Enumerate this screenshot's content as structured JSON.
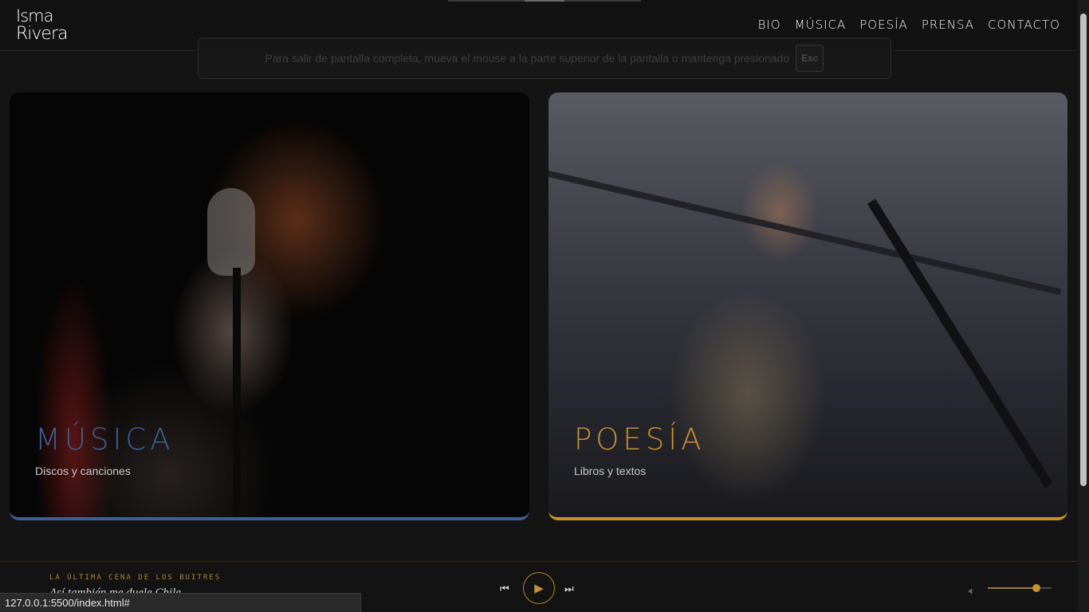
{
  "header": {
    "logo_line1": "Isma",
    "logo_line2": "Rivera",
    "nav": [
      "BIO",
      "MÚSICA",
      "POESÍA",
      "PRENSA",
      "CONTACTO"
    ]
  },
  "fullscreen_notice": {
    "text": "Para salir de pantalla completa, mueva el mouse a la parte superior de la pantalla o mantenga presionado",
    "key": "Esc"
  },
  "cards": {
    "music": {
      "title": "MÚSICA",
      "subtitle": "Discos y canciones",
      "accent": "#3d5f93"
    },
    "poesia": {
      "title": "POESÍA",
      "subtitle": "Libros y textos",
      "accent": "#c8912f"
    }
  },
  "player": {
    "album": "LA ÚLTIMA CENA DE LOS BUITRES",
    "track": "Así también me duele Chile",
    "volume": 0.76,
    "icons": [
      "prev-icon",
      "play-icon",
      "next-icon",
      "volume-icon"
    ]
  },
  "status_bar": {
    "url": "127.0.0.1:5500/index.html#"
  }
}
